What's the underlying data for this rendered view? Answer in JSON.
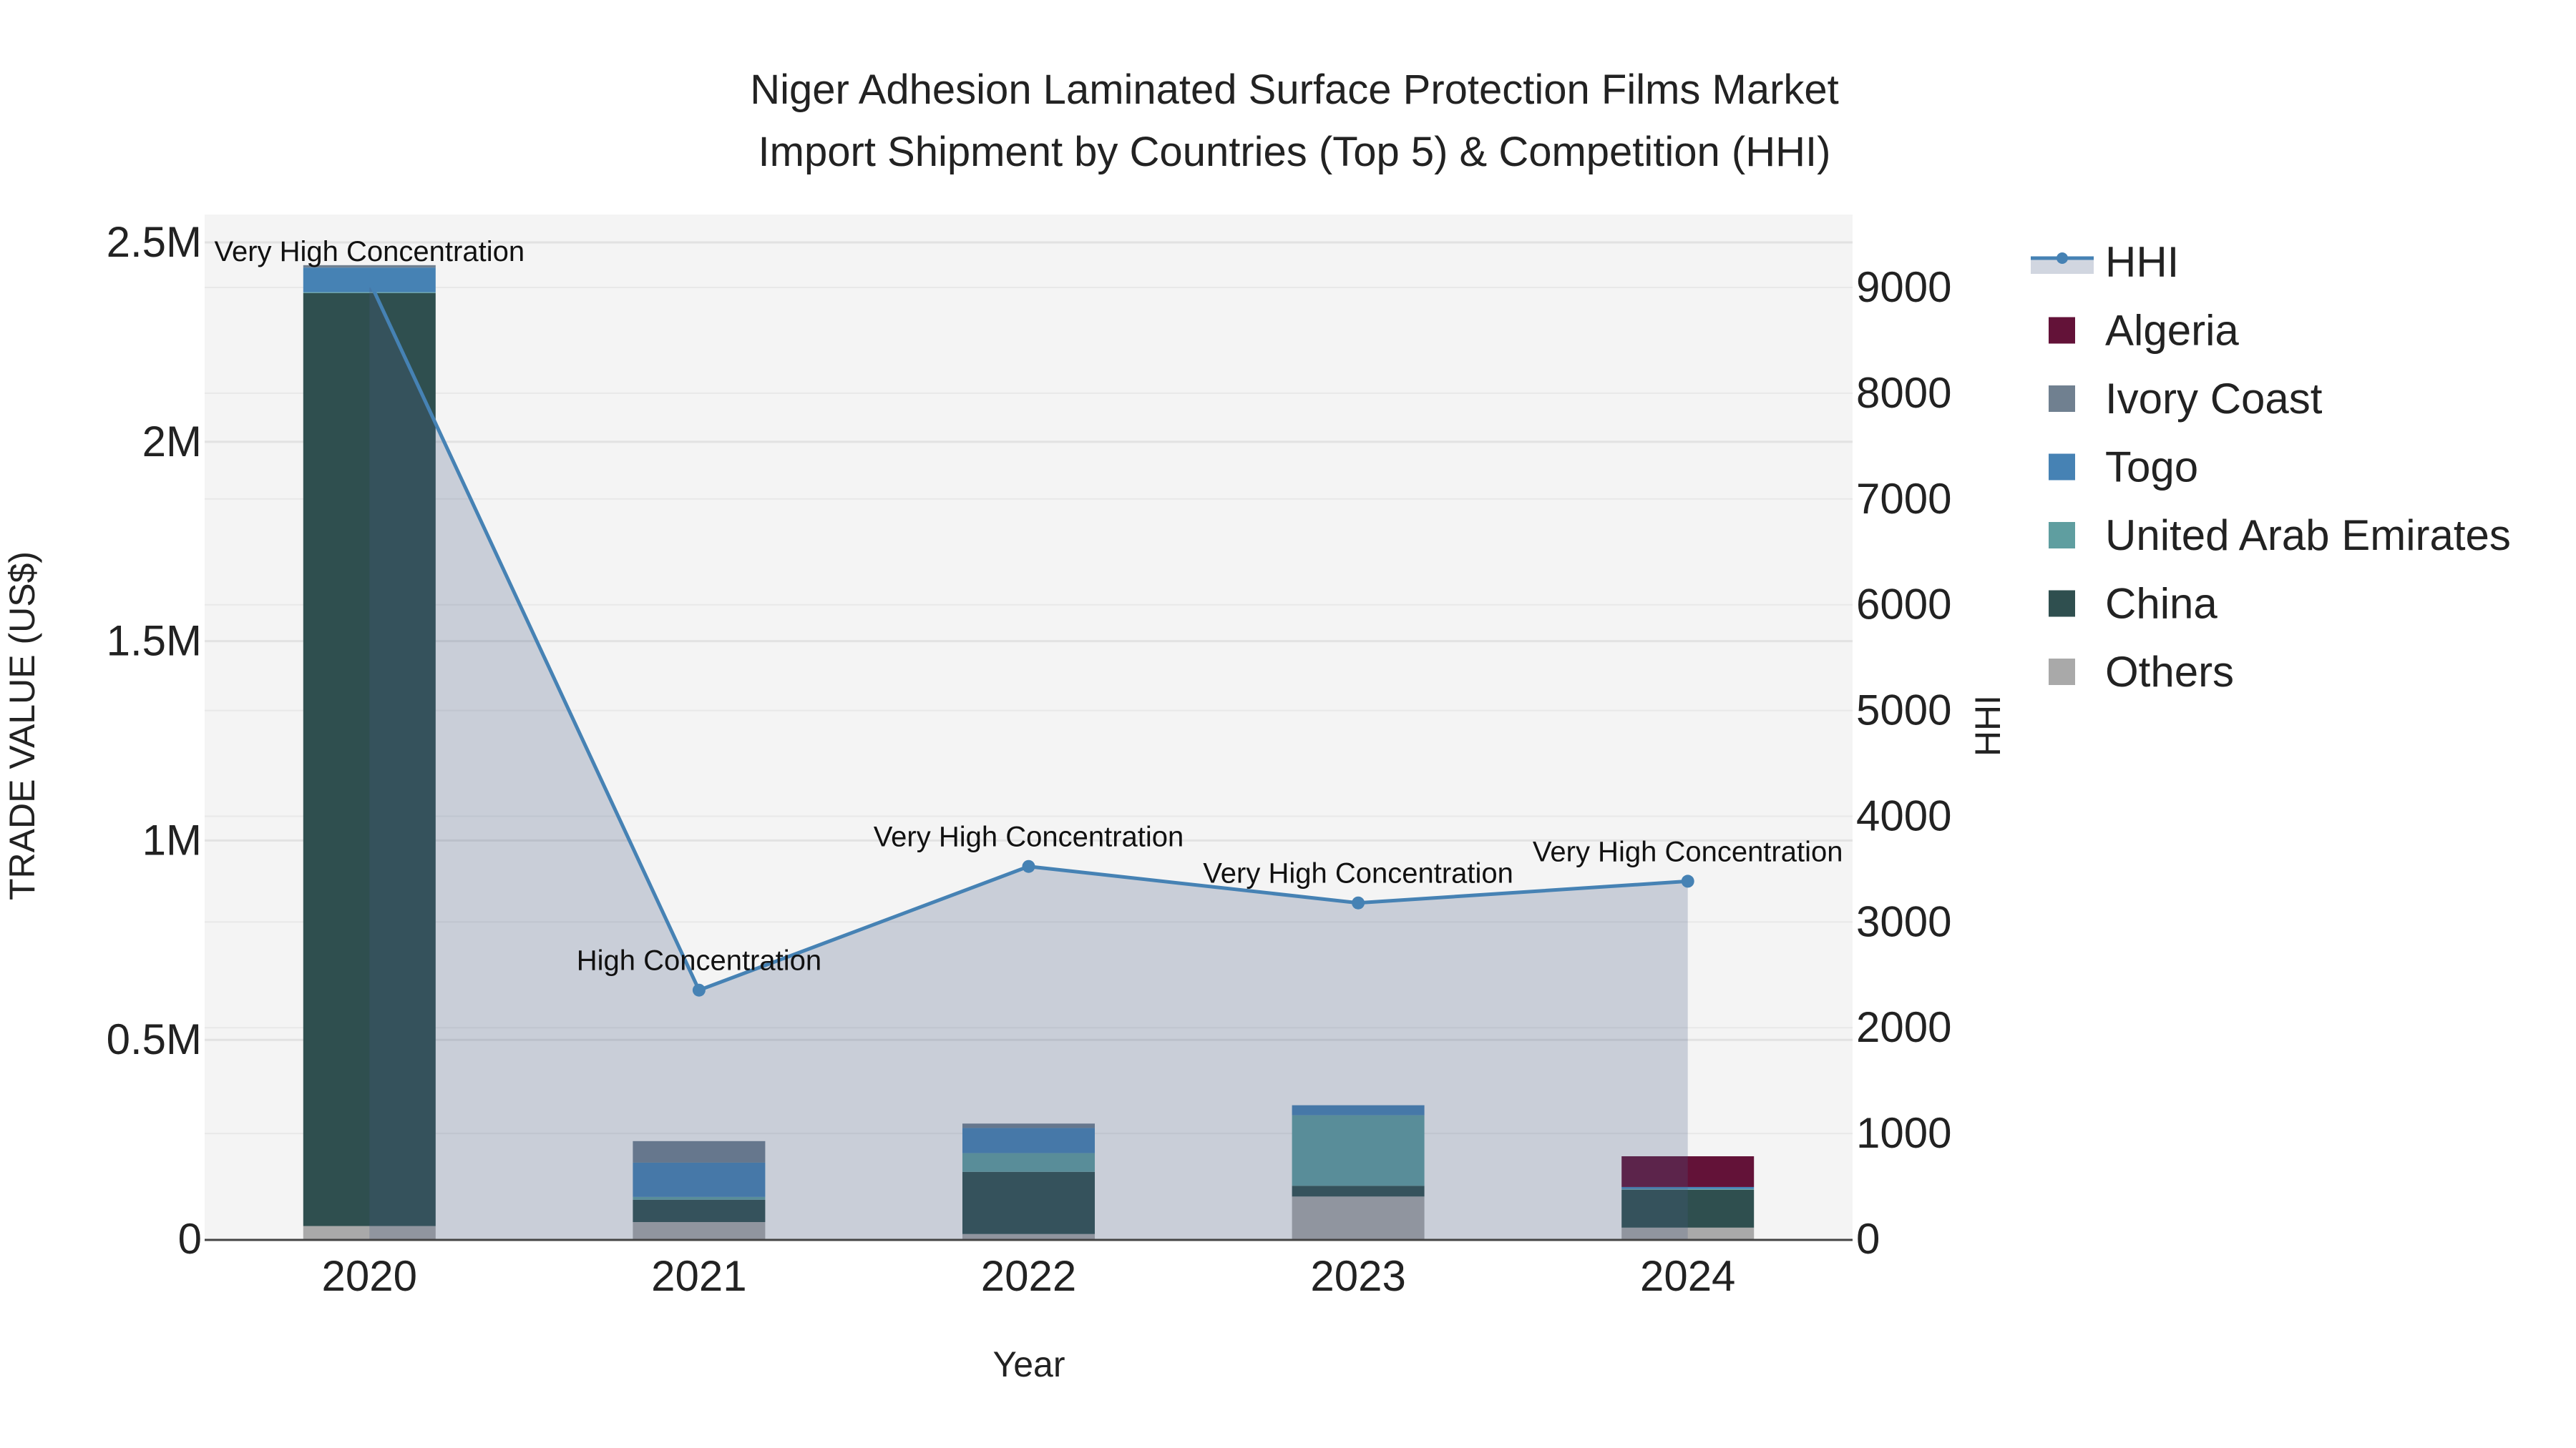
{
  "chart_data": {
    "type": "bar",
    "stacked": true,
    "title": "Niger Adhesion Laminated Surface Protection Films Market",
    "subtitle": "Import Shipment by Countries (Top 5) & Competition (HHI)",
    "xlabel": "Year",
    "ylabel": "TRADE VALUE (US$)",
    "y2label": "HHI",
    "categories": [
      "2020",
      "2021",
      "2022",
      "2023",
      "2024"
    ],
    "ylim": [
      0,
      2570000
    ],
    "y2lim": [
      0,
      9690
    ],
    "yticks": [
      {
        "v": 0,
        "label": "0"
      },
      {
        "v": 500000,
        "label": "0.5M"
      },
      {
        "v": 1000000,
        "label": "1M"
      },
      {
        "v": 1500000,
        "label": "1.5M"
      },
      {
        "v": 2000000,
        "label": "2M"
      },
      {
        "v": 2500000,
        "label": "2.5M"
      }
    ],
    "y2ticks": [
      0,
      1000,
      2000,
      3000,
      4000,
      5000,
      6000,
      7000,
      8000,
      9000
    ],
    "grid": true,
    "legend_position": "right",
    "series": [
      {
        "name": "Others",
        "color": "#a9a9a9",
        "values": [
          33000,
          43000,
          13000,
          107000,
          29000
        ]
      },
      {
        "name": "China",
        "color": "#2f4f4f",
        "values": [
          2340000,
          56000,
          156000,
          27000,
          95000
        ]
      },
      {
        "name": "United Arab Emirates",
        "color": "#5f9ea0",
        "values": [
          2000,
          7000,
          47000,
          177000,
          2000
        ]
      },
      {
        "name": "Togo",
        "color": "#4682b4",
        "values": [
          62000,
          86000,
          63000,
          25000,
          5000
        ]
      },
      {
        "name": "Ivory Coast",
        "color": "#708090",
        "values": [
          6000,
          54000,
          11000,
          0,
          0
        ]
      },
      {
        "name": "Algeria",
        "color": "#631238",
        "values": [
          0,
          0,
          0,
          0,
          77000
        ]
      }
    ],
    "hhi": {
      "name": "HHI",
      "color": "#4682b4",
      "values": [
        9060,
        2355,
        3525,
        3180,
        3385
      ],
      "annotations": [
        "Very High Concentration",
        "High Concentration",
        "Very High Concentration",
        "Very High Concentration",
        "Very High Concentration"
      ]
    },
    "legend_order": [
      "HHI",
      "Algeria",
      "Ivory Coast",
      "Togo",
      "United Arab Emirates",
      "China",
      "Others"
    ]
  }
}
